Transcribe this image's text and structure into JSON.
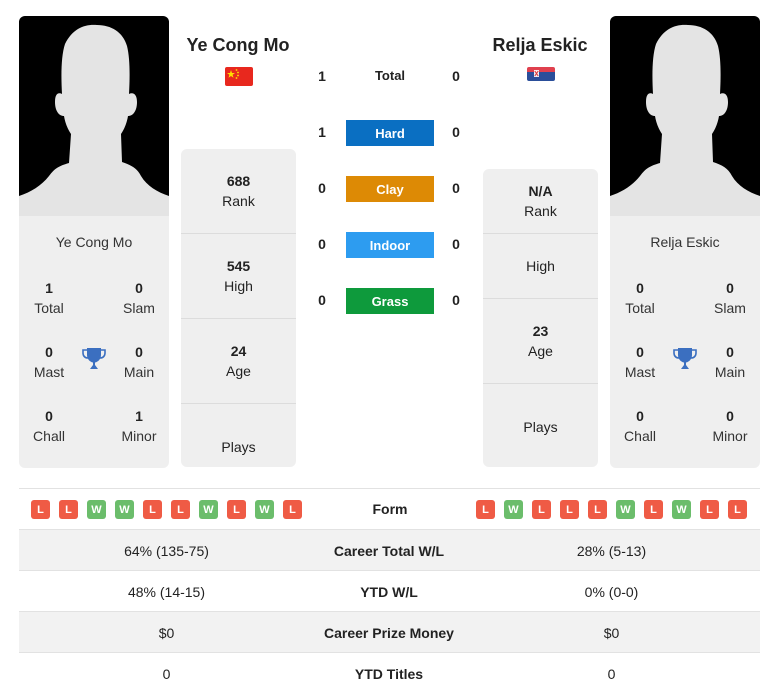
{
  "player1": {
    "name": "Ye Cong Mo",
    "country": "China",
    "card_name": "Ye Cong Mo",
    "titles": {
      "total": {
        "value": "1",
        "label": "Total"
      },
      "slam": {
        "value": "0",
        "label": "Slam"
      },
      "mast": {
        "value": "0",
        "label": "Mast"
      },
      "main": {
        "value": "0",
        "label": "Main"
      },
      "chall": {
        "value": "0",
        "label": "Chall"
      },
      "minor": {
        "value": "1",
        "label": "Minor"
      }
    },
    "stats": {
      "rank": {
        "value": "688",
        "label": "Rank"
      },
      "high": {
        "value": "545",
        "label": "High"
      },
      "age": {
        "value": "24",
        "label": "Age"
      },
      "plays": {
        "value": "",
        "label": "Plays"
      }
    },
    "form": [
      "L",
      "L",
      "W",
      "W",
      "L",
      "L",
      "W",
      "L",
      "W",
      "L"
    ]
  },
  "player2": {
    "name": "Relja Eskic",
    "country": "Serbia",
    "card_name": "Relja Eskic",
    "titles": {
      "total": {
        "value": "0",
        "label": "Total"
      },
      "slam": {
        "value": "0",
        "label": "Slam"
      },
      "mast": {
        "value": "0",
        "label": "Mast"
      },
      "main": {
        "value": "0",
        "label": "Main"
      },
      "chall": {
        "value": "0",
        "label": "Chall"
      },
      "minor": {
        "value": "0",
        "label": "Minor"
      }
    },
    "stats": {
      "rank": {
        "value": "N/A",
        "label": "Rank"
      },
      "high": {
        "value": "",
        "label": "High"
      },
      "age": {
        "value": "23",
        "label": "Age"
      },
      "plays": {
        "value": "",
        "label": "Plays"
      }
    },
    "form": [
      "L",
      "W",
      "L",
      "L",
      "L",
      "W",
      "L",
      "W",
      "L",
      "L"
    ]
  },
  "h2h": {
    "total": {
      "label": "Total",
      "p1": "1",
      "p2": "0"
    },
    "surfaces": [
      {
        "label": "Hard",
        "p1": "1",
        "p2": "0",
        "color": "#0a6fc2"
      },
      {
        "label": "Clay",
        "p1": "0",
        "p2": "0",
        "color": "#dd8a05"
      },
      {
        "label": "Indoor",
        "p1": "0",
        "p2": "0",
        "color": "#2d9cf0"
      },
      {
        "label": "Grass",
        "p1": "0",
        "p2": "0",
        "color": "#0e9a3c"
      }
    ]
  },
  "form_label": "Form",
  "comparison": [
    {
      "label": "Career Total W/L",
      "p1": "64% (135-75)",
      "p2": "28% (5-13)"
    },
    {
      "label": "YTD W/L",
      "p1": "48% (14-15)",
      "p2": "0% (0-0)"
    },
    {
      "label": "Career Prize Money",
      "p1": "$0",
      "p2": "$0"
    },
    {
      "label": "YTD Titles",
      "p1": "0",
      "p2": "0"
    }
  ],
  "colors": {
    "loss": "#ef5b45",
    "win": "#6bbd6b",
    "trophy": "#3b6fc0"
  }
}
